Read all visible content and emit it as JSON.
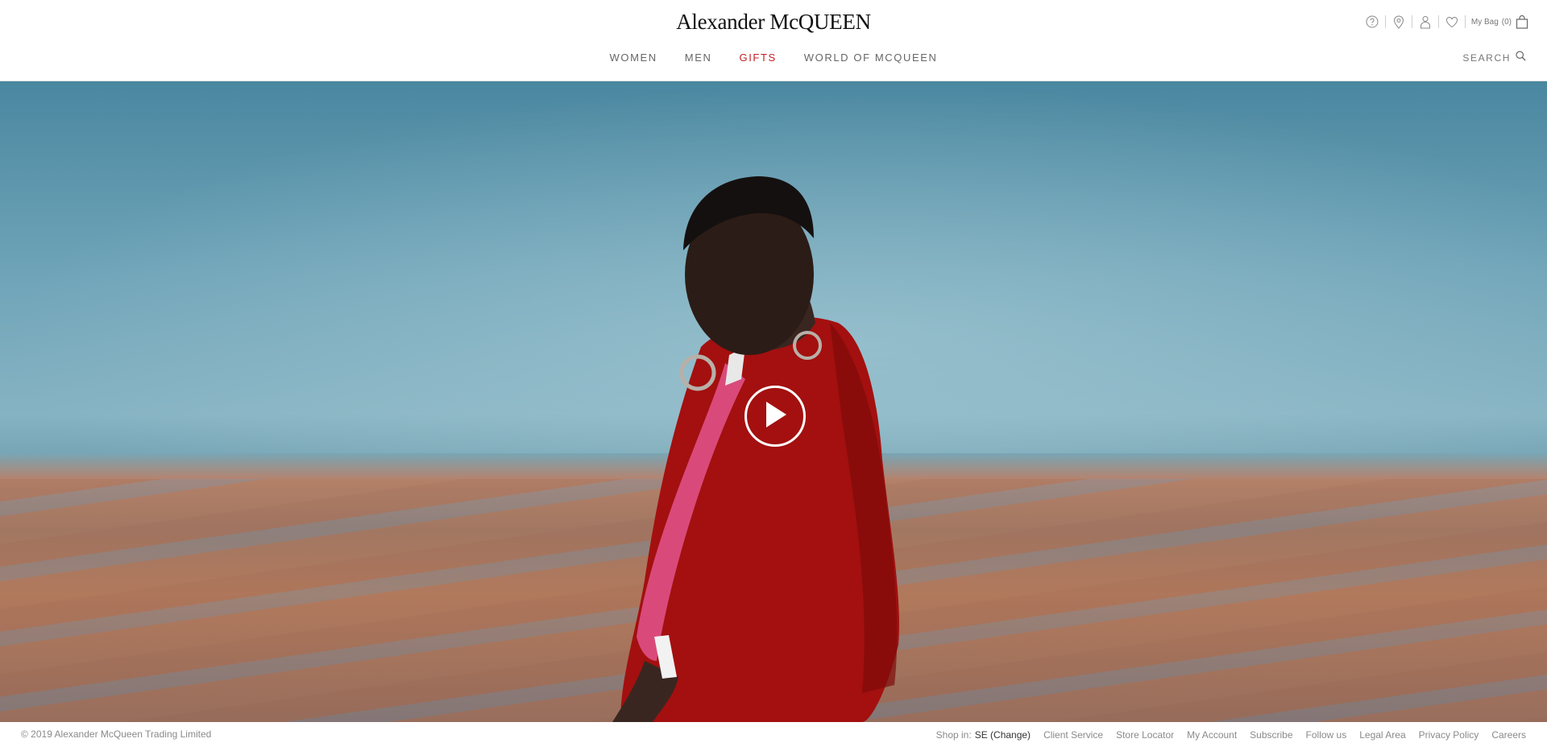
{
  "brand": {
    "logo": "Alexander McQUEEN"
  },
  "nav": {
    "items": [
      {
        "label": "WOMEN"
      },
      {
        "label": "MEN"
      },
      {
        "label": "GIFTS"
      },
      {
        "label": "WORLD OF MCQUEEN"
      }
    ],
    "accent_color": "#c41e24"
  },
  "utility": {
    "icons": [
      "help-icon",
      "store-locator-icon",
      "account-icon",
      "wishlist-icon",
      "bag-icon"
    ],
    "bag_label": "My Bag",
    "bag_count": "(0)"
  },
  "search": {
    "label": "SEARCH"
  },
  "hero": {
    "media": "video",
    "play_icon": "play-icon"
  },
  "footer": {
    "copyright": "© 2019 Alexander McQueen Trading Limited",
    "shop_in_label": "Shop in:",
    "shop_in_value": "SE (Change)",
    "links": [
      "Client Service",
      "Store Locator",
      "My Account",
      "Subscribe",
      "Follow us",
      "Legal Area",
      "Privacy Policy",
      "Careers"
    ]
  }
}
